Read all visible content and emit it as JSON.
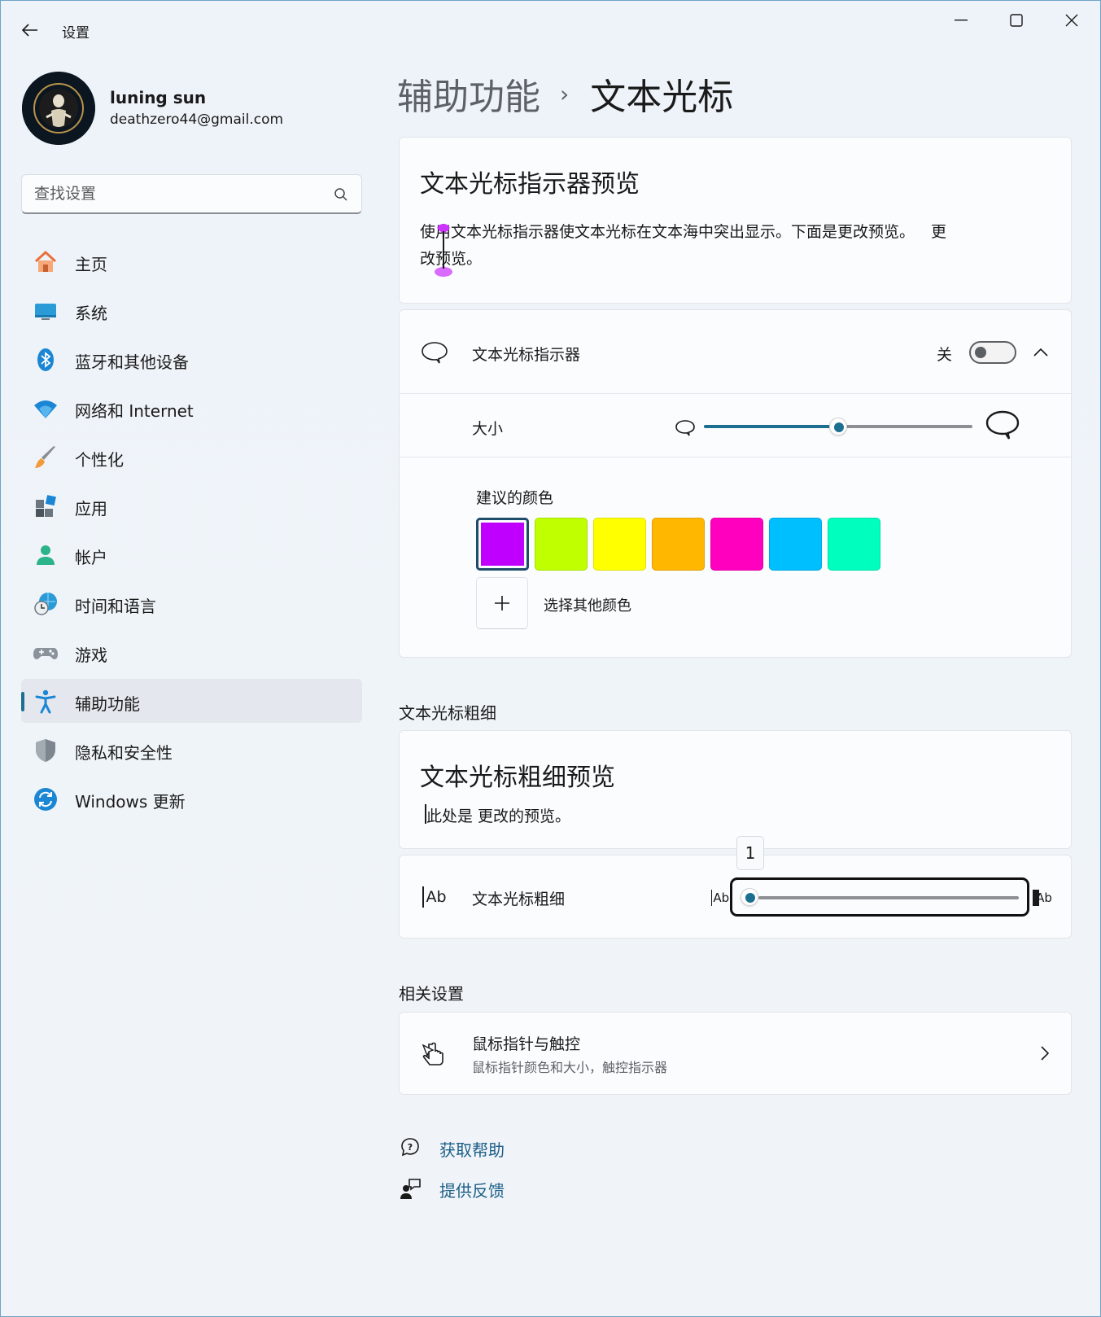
{
  "app": {
    "title": "设置"
  },
  "profile": {
    "name": "luning sun",
    "email": "deathzero44@gmail.com"
  },
  "search": {
    "placeholder": "查找设置"
  },
  "nav": {
    "items": [
      {
        "label": "主页",
        "icon": "home-icon"
      },
      {
        "label": "系统",
        "icon": "system-icon"
      },
      {
        "label": "蓝牙和其他设备",
        "icon": "bluetooth-icon"
      },
      {
        "label": "网络和 Internet",
        "icon": "wifi-icon"
      },
      {
        "label": "个性化",
        "icon": "brush-icon"
      },
      {
        "label": "应用",
        "icon": "apps-icon"
      },
      {
        "label": "帐户",
        "icon": "account-icon"
      },
      {
        "label": "时间和语言",
        "icon": "globe-clock-icon"
      },
      {
        "label": "游戏",
        "icon": "gamepad-icon"
      },
      {
        "label": "辅助功能",
        "icon": "accessibility-icon",
        "active": true
      },
      {
        "label": "隐私和安全性",
        "icon": "shield-icon"
      },
      {
        "label": "Windows 更新",
        "icon": "update-icon"
      }
    ]
  },
  "breadcrumb": {
    "parent": "辅助功能",
    "separator": "›",
    "current": "文本光标"
  },
  "indicator_preview": {
    "title": "文本光标指示器预览",
    "text_before": "使用文本光标指示器使文本光标在文本海中突出显示。下面是更改预览。",
    "text_after": "更改预览。",
    "color": "#cc33ff"
  },
  "indicator": {
    "label": "文本光标指示器",
    "toggle_state": "关",
    "toggle_on": false,
    "size_label": "大小",
    "size_value": 0.5,
    "suggested_colors_label": "建议的颜色",
    "colors": [
      "#bf00ff",
      "#bfff00",
      "#ffff00",
      "#ffb700",
      "#ff00bf",
      "#00bfff",
      "#00ffbf"
    ],
    "selected_color_index": 0,
    "add_color_label": "选择其他颜色",
    "accent": "#1d6f92"
  },
  "thickness": {
    "section_title": "文本光标粗细",
    "preview_title": "文本光标粗细预览",
    "preview_text": "此处是 更改的预览。",
    "label": "文本光标粗细",
    "value": "1",
    "min_icon_text": "Ab",
    "max_icon_text": "Ab",
    "row_icon_text": "Ab"
  },
  "related": {
    "section_title": "相关设置",
    "item_title": "鼠标指针与触控",
    "item_subtitle": "鼠标指针颜色和大小，触控指示器"
  },
  "links": {
    "help": "获取帮助",
    "feedback": "提供反馈"
  }
}
